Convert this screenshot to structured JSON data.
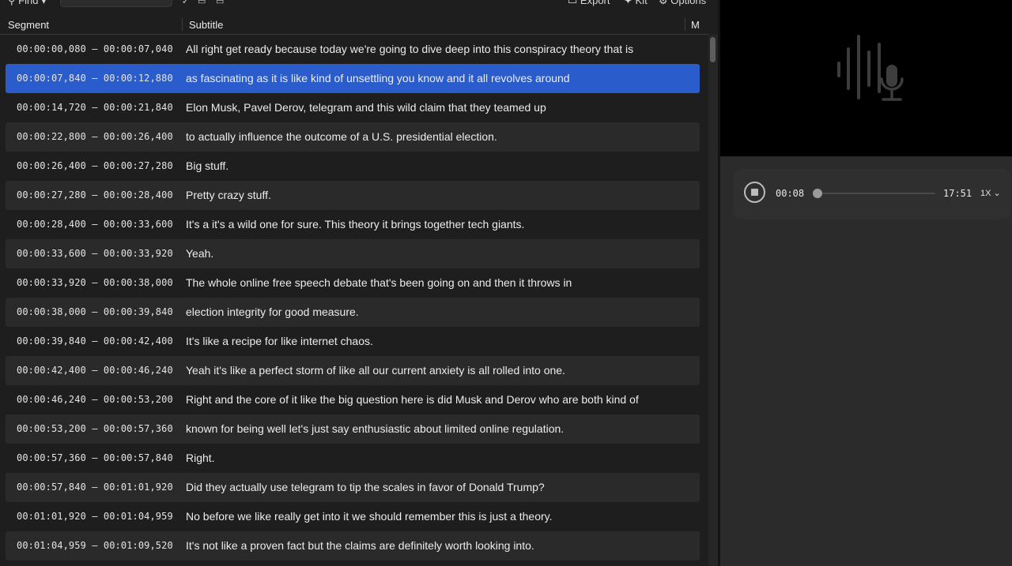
{
  "toolbar": {
    "find_label": "Find",
    "export_label": "Export",
    "kit_label": "Kit",
    "options_label": "Options"
  },
  "table": {
    "columns": [
      "Segment",
      "Subtitle",
      "M"
    ],
    "rows": [
      {
        "time": "00:00:00,080 – 00:00:07,040",
        "text": "All right get ready because today we're going to dive deep into this conspiracy theory that is"
      },
      {
        "time": "00:00:07,840 – 00:00:12,880",
        "text": "as fascinating as it is like kind of unsettling you know and it all revolves around"
      },
      {
        "time": "00:00:14,720 – 00:00:21,840",
        "text": "Elon Musk, Pavel Derov, telegram and this wild claim that they teamed up"
      },
      {
        "time": "00:00:22,800 – 00:00:26,400",
        "text": "to actually influence the outcome of a U.S. presidential election."
      },
      {
        "time": "00:00:26,400 – 00:00:27,280",
        "text": "Big stuff."
      },
      {
        "time": "00:00:27,280 – 00:00:28,400",
        "text": "Pretty crazy stuff."
      },
      {
        "time": "00:00:28,400 – 00:00:33,600",
        "text": "It's a it's a wild one for sure. This theory it brings together tech giants."
      },
      {
        "time": "00:00:33,600 – 00:00:33,920",
        "text": "Yeah."
      },
      {
        "time": "00:00:33,920 – 00:00:38,000",
        "text": "The whole online free speech debate that's been going on and then it throws in"
      },
      {
        "time": "00:00:38,000 – 00:00:39,840",
        "text": "election integrity for good measure."
      },
      {
        "time": "00:00:39,840 – 00:00:42,400",
        "text": "It's like a recipe for like internet chaos."
      },
      {
        "time": "00:00:42,400 – 00:00:46,240",
        "text": "Yeah it's like a perfect storm of like all our current anxiety is all rolled into one."
      },
      {
        "time": "00:00:46,240 – 00:00:53,200",
        "text": "Right and the core of it like the big question here is did Musk and Derov who are both kind of"
      },
      {
        "time": "00:00:53,200 – 00:00:57,360",
        "text": "known for being well let's just say enthusiastic about limited online regulation."
      },
      {
        "time": "00:00:57,360 – 00:00:57,840",
        "text": "Right."
      },
      {
        "time": "00:00:57,840 – 00:01:01,920",
        "text": "Did they actually use telegram to tip the scales in favor of Donald Trump?"
      },
      {
        "time": "00:01:01,920 – 00:01:04,959",
        "text": "No before we like really get into it we should remember this is just a theory."
      },
      {
        "time": "00:01:04,959 – 00:01:09,520",
        "text": "It's not like a proven fact but the claims are definitely worth looking into."
      }
    ],
    "selected_index": 1
  },
  "player": {
    "current_time": "00:08",
    "total_time": "17:51",
    "progress": 0.007,
    "speed": "1X"
  },
  "preview": {
    "icon": "audio-waveform-microphone-icon"
  },
  "colors": {
    "selection": "#2b5ccc",
    "background": "#1e1e1e",
    "alt_row": "#2a2a2a"
  }
}
